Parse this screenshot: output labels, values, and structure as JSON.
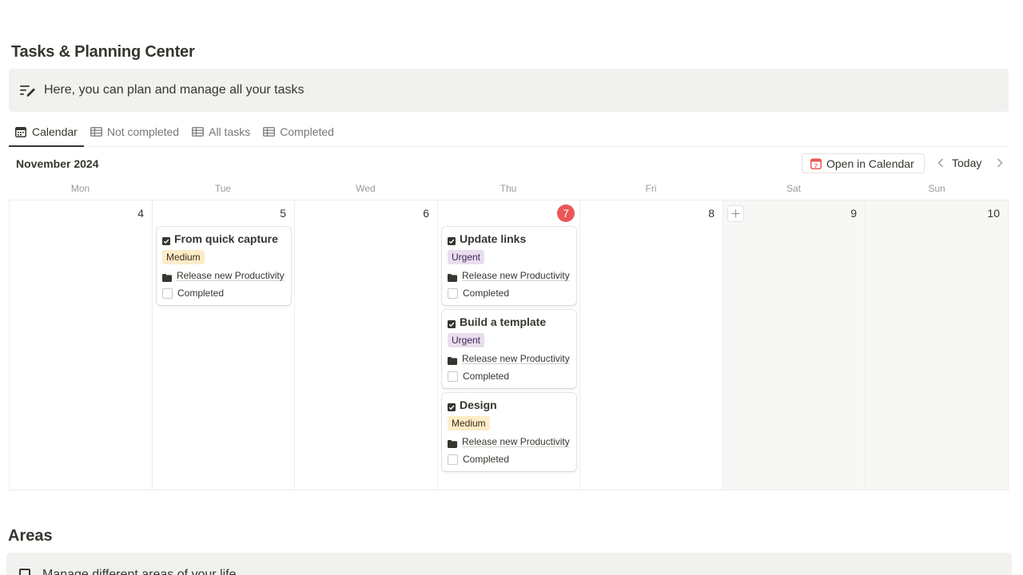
{
  "page": {
    "title": "Tasks & Planning Center",
    "callout": {
      "icon": "pen-lines-icon",
      "text": "Here, you can plan and manage all your tasks"
    }
  },
  "tabs": [
    {
      "label": "Calendar",
      "icon": "calendar-icon",
      "active": true
    },
    {
      "label": "Not completed",
      "icon": "table-icon",
      "active": false
    },
    {
      "label": "All tasks",
      "icon": "table-icon",
      "active": false
    },
    {
      "label": "Completed",
      "icon": "table-icon",
      "active": false
    }
  ],
  "calendar": {
    "month": "November 2024",
    "open_button": "Open in Calendar",
    "today": "Today",
    "weekdays": [
      "Mon",
      "Tue",
      "Wed",
      "Thu",
      "Fri",
      "Sat",
      "Sun"
    ],
    "days": [
      {
        "num": "4",
        "today": false,
        "weekend": false,
        "cards": []
      },
      {
        "num": "5",
        "today": false,
        "weekend": false,
        "cards": [
          {
            "title": "From quick capture",
            "priority": "Medium",
            "project": "Release new Productivity",
            "status": "Completed"
          }
        ]
      },
      {
        "num": "6",
        "today": false,
        "weekend": false,
        "cards": []
      },
      {
        "num": "7",
        "today": true,
        "weekend": false,
        "cards": [
          {
            "title": "Update links",
            "priority": "Urgent",
            "project": "Release new Productivity",
            "status": "Completed"
          },
          {
            "title": "Build a template",
            "priority": "Urgent",
            "project": "Release new Productivity",
            "status": "Completed"
          },
          {
            "title": "Design",
            "priority": "Medium",
            "project": "Release new Productivity",
            "status": "Completed"
          }
        ]
      },
      {
        "num": "8",
        "today": false,
        "weekend": false,
        "cards": []
      },
      {
        "num": "9",
        "today": false,
        "weekend": true,
        "add_button": true,
        "cards": []
      },
      {
        "num": "10",
        "today": false,
        "weekend": true,
        "cards": []
      }
    ]
  },
  "priority_colors": {
    "Medium": {
      "bg": "#fdecc8",
      "fg": "#402c1b"
    },
    "Urgent": {
      "bg": "#e8deee",
      "fg": "#412454"
    }
  },
  "areas": {
    "title": "Areas",
    "callout_text": "Manage different areas of your life"
  }
}
